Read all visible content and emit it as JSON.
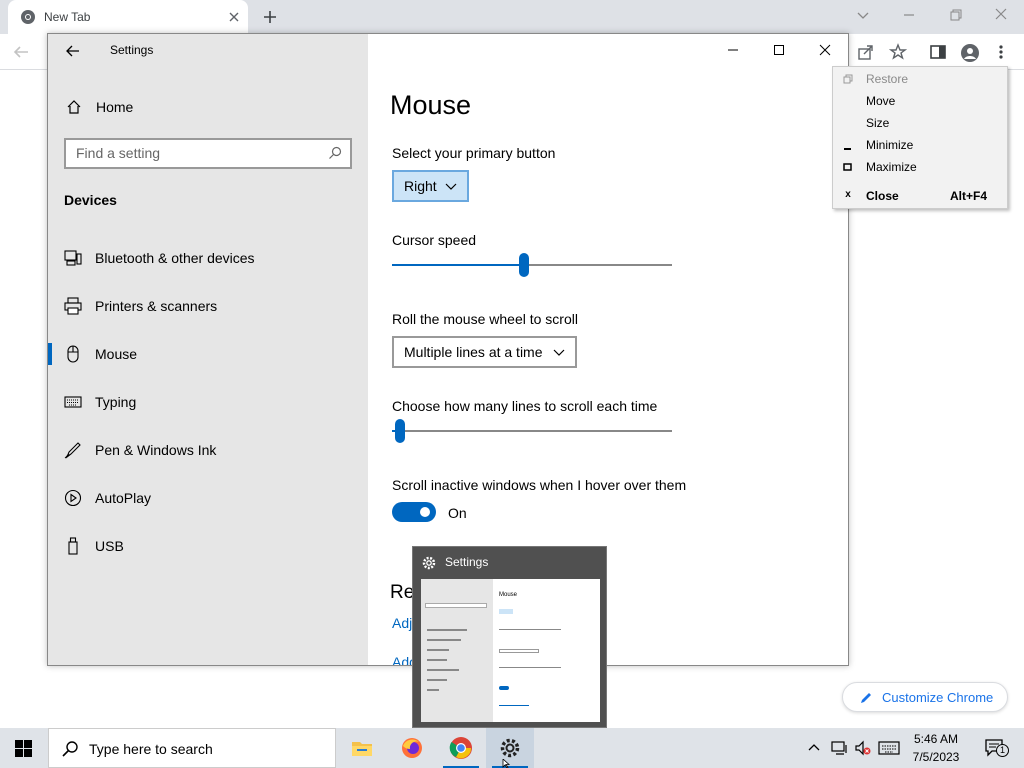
{
  "browser": {
    "tab_title": "New Tab",
    "customize_label": "Customize Chrome"
  },
  "system_menu": {
    "items": [
      {
        "label": "Restore",
        "icon": "restore-icon",
        "enabled": false
      },
      {
        "label": "Move",
        "icon": "",
        "enabled": true
      },
      {
        "label": "Size",
        "icon": "",
        "enabled": true
      },
      {
        "label": "Minimize",
        "icon": "minimize-icon",
        "enabled": true
      },
      {
        "label": "Maximize",
        "icon": "maximize-icon",
        "enabled": true
      },
      {
        "label": "Close",
        "icon": "close-icon",
        "enabled": true,
        "accelerator": "Alt+F4"
      }
    ],
    "close_icon_glyph": "x"
  },
  "settings": {
    "window_title": "Settings",
    "home_label": "Home",
    "search_placeholder": "Find a setting",
    "section_heading": "Devices",
    "nav": [
      {
        "label": "Bluetooth & other devices",
        "icon": "bluetooth-devices-icon",
        "active": false
      },
      {
        "label": "Printers & scanners",
        "icon": "printer-icon",
        "active": false
      },
      {
        "label": "Mouse",
        "icon": "mouse-icon",
        "active": true
      },
      {
        "label": "Typing",
        "icon": "keyboard-icon",
        "active": false
      },
      {
        "label": "Pen & Windows Ink",
        "icon": "pen-icon",
        "active": false
      },
      {
        "label": "AutoPlay",
        "icon": "autoplay-icon",
        "active": false
      },
      {
        "label": "USB",
        "icon": "usb-icon",
        "active": false
      }
    ],
    "page_title": "Mouse",
    "primary_button": {
      "label": "Select your primary button",
      "value": "Right"
    },
    "cursor_speed": {
      "label": "Cursor speed",
      "level": 0.47
    },
    "wheel_scroll": {
      "label": "Roll the mouse wheel to scroll",
      "value": "Multiple lines at a time"
    },
    "lines_to_scroll": {
      "label": "Choose how many lines to scroll each time",
      "level": 0.03
    },
    "scroll_inactive": {
      "label": "Scroll inactive windows when I hover over them",
      "state": "On",
      "on": true
    },
    "related_heading": "Rel",
    "related_links": [
      "Adj",
      "Add"
    ]
  },
  "thumbnail": {
    "title": "Settings",
    "preview_heading": "Mouse"
  },
  "taskbar": {
    "search_placeholder": "Type here to search",
    "apps": [
      "file-explorer-icon",
      "firefox-icon",
      "chrome-icon",
      "settings-gear-icon"
    ],
    "time": "5:46 AM",
    "date": "7/5/2023",
    "notification_count": "1"
  },
  "colors": {
    "accent": "#0067c0",
    "link": "#1a73e8"
  }
}
